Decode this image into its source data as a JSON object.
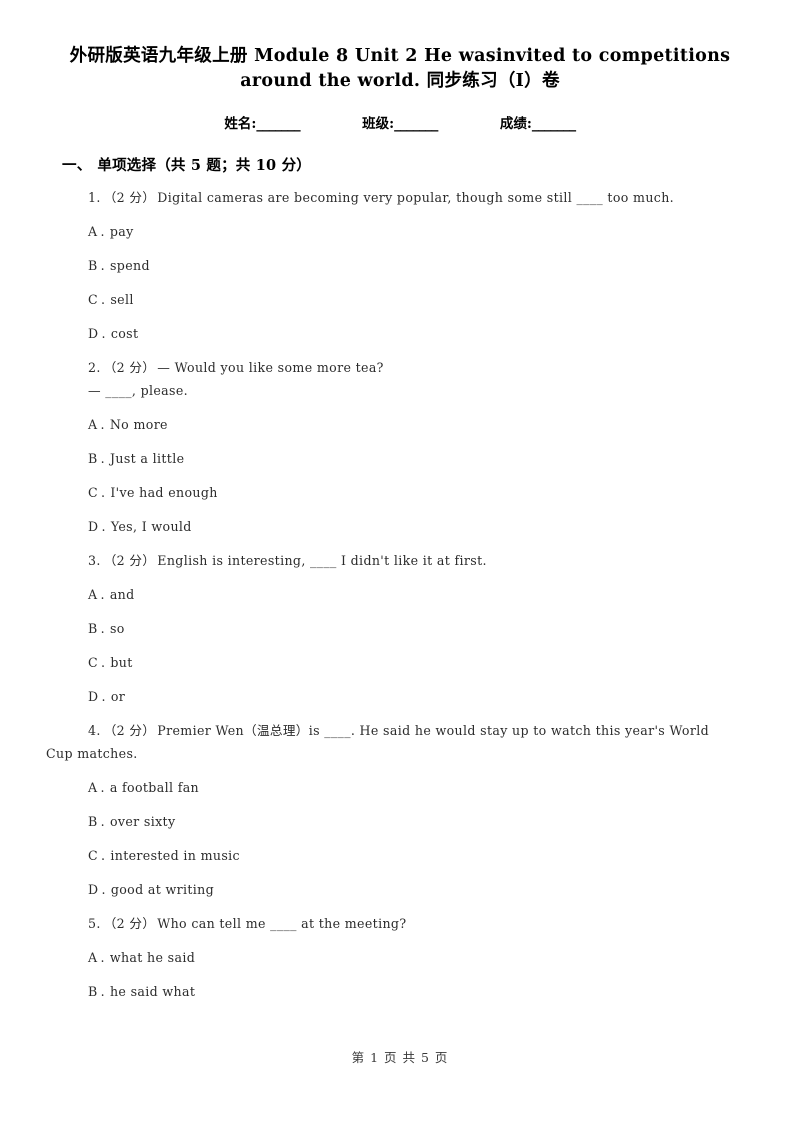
{
  "document": {
    "title_line1": "外研版英语九年级上册 Module 8 Unit 2 He wasinvited to competitions",
    "title_line2": "around the world. 同步练习（I）卷"
  },
  "info_fields": [
    {
      "label": "姓名:",
      "blank": "_______"
    },
    {
      "label": "班级:",
      "blank": "_______"
    },
    {
      "label": "成绩:",
      "blank": "_______"
    }
  ],
  "section": {
    "number": "一、",
    "title": "单项选择（共 5 题；共 10 分）"
  },
  "questions": [
    {
      "number": "1.",
      "score": "（2 分）",
      "stem": "Digital cameras are becoming very popular, though some still ____ too much.",
      "continuation": "",
      "options": [
        {
          "letter": "A",
          "dot": ".",
          "text": "pay"
        },
        {
          "letter": "B",
          "dot": ".",
          "text": "spend"
        },
        {
          "letter": "C",
          "dot": ".",
          "text": "sell"
        },
        {
          "letter": "D",
          "dot": ".",
          "text": "cost"
        }
      ]
    },
    {
      "number": "2.",
      "score": "（2 分）",
      "stem": "— Would you like some more tea?",
      "continuation": "— ____, please.",
      "options": [
        {
          "letter": "A",
          "dot": ".",
          "text": "No more"
        },
        {
          "letter": "B",
          "dot": ".",
          "text": "Just a little"
        },
        {
          "letter": "C",
          "dot": ".",
          "text": "I've had enough"
        },
        {
          "letter": "D",
          "dot": ".",
          "text": "Yes, I would"
        }
      ]
    },
    {
      "number": "3.",
      "score": "（2 分）",
      "stem": "English is interesting, ____ I didn't like it at first.",
      "continuation": "",
      "options": [
        {
          "letter": "A",
          "dot": ".",
          "text": "and"
        },
        {
          "letter": "B",
          "dot": ".",
          "text": "so"
        },
        {
          "letter": "C",
          "dot": ".",
          "text": "but"
        },
        {
          "letter": "D",
          "dot": ".",
          "text": "or"
        }
      ]
    },
    {
      "number": "4.",
      "score": "（2 分）",
      "stem": "Premier Wen（温总理）is ____. He said he would stay up to watch this year's World",
      "continuation": "Cup matches.",
      "options": [
        {
          "letter": "A",
          "dot": ".",
          "text": "a football fan"
        },
        {
          "letter": "B",
          "dot": ".",
          "text": "over sixty"
        },
        {
          "letter": "C",
          "dot": ".",
          "text": "interested in music"
        },
        {
          "letter": "D",
          "dot": ".",
          "text": "good at writing"
        }
      ]
    },
    {
      "number": "5.",
      "score": "（2 分）",
      "stem": "Who can tell me ____ at the meeting?",
      "continuation": "",
      "options": [
        {
          "letter": "A",
          "dot": ".",
          "text": "what he said"
        },
        {
          "letter": "B",
          "dot": ".",
          "text": "he said what"
        }
      ]
    }
  ],
  "footer": {
    "text": "第 1 页 共 5 页"
  }
}
